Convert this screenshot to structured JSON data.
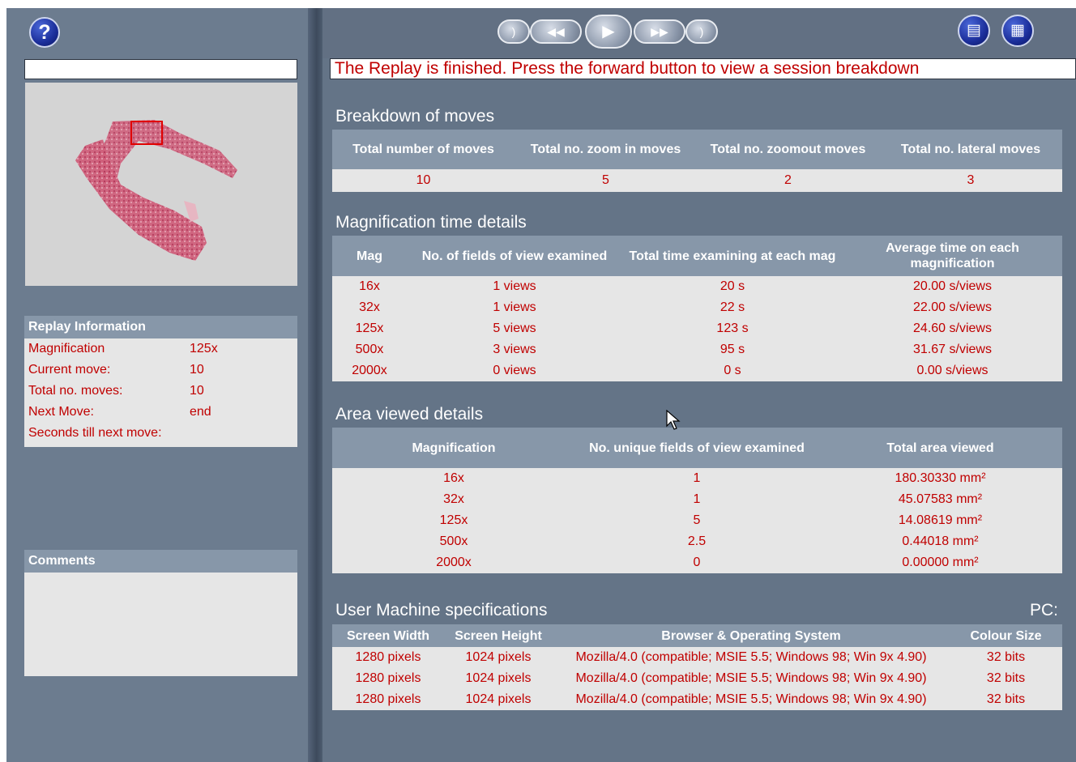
{
  "left": {
    "help_label": "?",
    "search_value": "",
    "replay_title": "Replay Information",
    "replay_rows": [
      {
        "k": "Magnification",
        "v": "125x"
      },
      {
        "k": "Current move:",
        "v": "10"
      },
      {
        "k": "Total no. moves:",
        "v": "10"
      },
      {
        "k": "Next Move:",
        "v": "end"
      },
      {
        "k": "Seconds till next move:",
        "v": ""
      }
    ],
    "comments_title": "Comments"
  },
  "status": "The Replay is finished. Press the forward button to view a session breakdown",
  "moves": {
    "title": "Breakdown of moves",
    "headers": [
      "Total number of moves",
      "Total no. zoom in moves",
      "Total no. zoomout moves",
      "Total no. lateral moves"
    ],
    "row": [
      "10",
      "5",
      "2",
      "3"
    ]
  },
  "mag": {
    "title": "Magnification time details",
    "headers": [
      "Mag",
      "No. of fields of view examined",
      "Total time examining at each mag",
      "Average time on each magnification"
    ],
    "rows": [
      [
        "16x",
        "1 views",
        "20 s",
        "20.00 s/views"
      ],
      [
        "32x",
        "1 views",
        "22 s",
        "22.00 s/views"
      ],
      [
        "125x",
        "5 views",
        "123 s",
        "24.60 s/views"
      ],
      [
        "500x",
        "3 views",
        "95 s",
        "31.67 s/views"
      ],
      [
        "2000x",
        "0 views",
        "0 s",
        "0.00 s/views"
      ]
    ]
  },
  "area": {
    "title": "Area viewed details",
    "headers": [
      "Magnification",
      "No. unique fields of view examined",
      "Total area viewed"
    ],
    "rows": [
      [
        "16x",
        "1",
        "180.30330 mm²"
      ],
      [
        "32x",
        "1",
        "45.07583 mm²"
      ],
      [
        "125x",
        "5",
        "14.08619 mm²"
      ],
      [
        "500x",
        "2.5",
        "0.44018 mm²"
      ],
      [
        "2000x",
        "0",
        "0.00000 mm²"
      ]
    ]
  },
  "machine": {
    "title": "User Machine specifications",
    "pc_label": "PC:",
    "headers": [
      "Screen Width",
      "Screen Height",
      "Browser & Operating System",
      "Colour Size"
    ],
    "rows": [
      [
        "1280 pixels",
        "1024 pixels",
        "Mozilla/4.0 (compatible; MSIE 5.5; Windows 98; Win 9x 4.90)",
        "32 bits"
      ],
      [
        "1280 pixels",
        "1024 pixels",
        "Mozilla/4.0 (compatible; MSIE 5.5; Windows 98; Win 9x 4.90)",
        "32 bits"
      ],
      [
        "1280 pixels",
        "1024 pixels",
        "Mozilla/4.0 (compatible; MSIE 5.5; Windows 98; Win 9x 4.90)",
        "32 bits"
      ]
    ]
  },
  "toolbar": {
    "icons": [
      "first-icon",
      "rewind-icon",
      "play-icon",
      "fast-forward-icon",
      "last-icon",
      "document-icon",
      "documents-icon"
    ]
  },
  "colors": {
    "background": "#647487",
    "header": "#8797a9",
    "cell": "#e6e6e6",
    "text_red": "#c00000"
  }
}
